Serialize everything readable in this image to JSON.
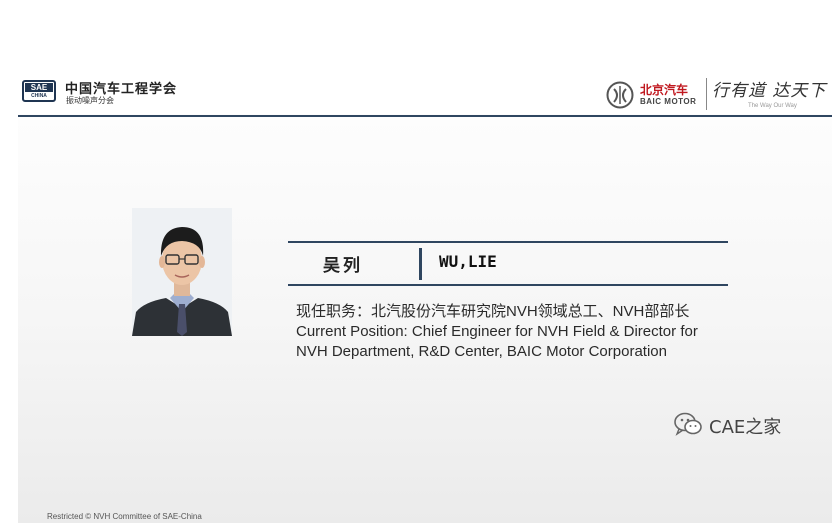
{
  "header": {
    "org_logo_top": "SAE",
    "org_logo_bottom": "CHINA",
    "org_name": "中国汽车工程学会",
    "org_sub": "振动噪声分会",
    "baic_cn": "北京汽车",
    "baic_en": "BAIC MOTOR",
    "slogan": "行有道 达天下",
    "slogan_en": "The Way Our Way"
  },
  "profile": {
    "name_cn": "吴列",
    "name_en": "WU,LIE",
    "position_lines": [
      "现任职务：北汽股份汽车研究院NVH领域总工、NVH部部长",
      "Current Position: Chief Engineer for NVH Field & Director for",
      "NVH Department, R&D Center, BAIC Motor Corporation"
    ]
  },
  "footer": {
    "text": "Restricted © NVH Committee of SAE-China"
  },
  "watermark": {
    "icon": "wechat-icon",
    "text": "CAE之家"
  },
  "colors": {
    "rule": "#2f4660",
    "baic_red": "#c0181f"
  }
}
